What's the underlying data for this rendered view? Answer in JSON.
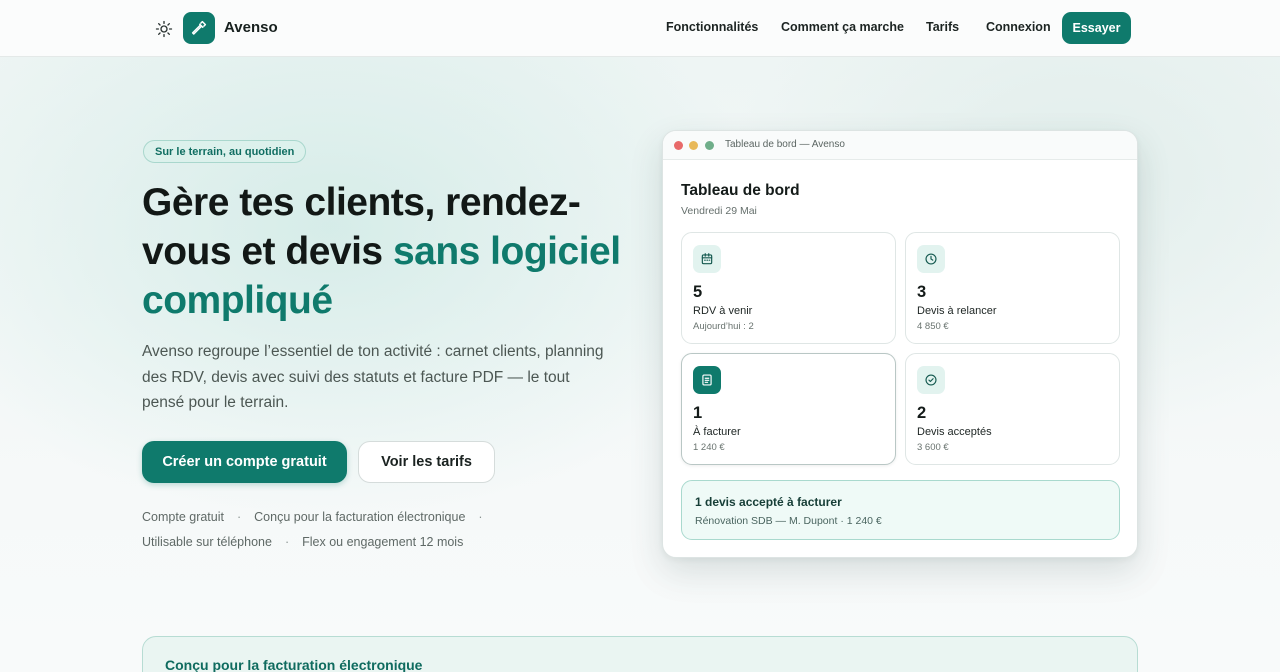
{
  "nav": {
    "brand": "Avenso",
    "links": [
      {
        "label": "Fonctionnalités"
      },
      {
        "label": "Comment ça marche"
      },
      {
        "label": "Tarifs"
      },
      {
        "label": "Connexion"
      }
    ],
    "cta": "Essayer",
    "icons": {
      "theme": "sun-icon",
      "logo": "hammer-icon"
    }
  },
  "hero": {
    "badge": "Sur le terrain, au quotidien",
    "headline_part1": "Gère tes clients, rendez-vous et devis",
    "headline_accent": "sans logiciel compliqué",
    "lede": "Avenso regroupe l’essentiel de ton activité : carnet clients, planning des RDV, devis avec suivi des statuts et facture PDF — le tout pensé pour le terrain.",
    "primary_button": "Créer un compte gratuit",
    "secondary_button": "Voir les tarifs",
    "features": [
      "Compte gratuit",
      "Conçu pour la facturation électronique",
      "Utilisable sur téléphone",
      "Flex ou engagement 12 mois"
    ],
    "separator": "·"
  },
  "dashboard": {
    "window_title": "Tableau de bord — Avenso",
    "title": "Tableau de bord",
    "date": "Vendredi 29 Mai",
    "cards": [
      {
        "icon": "calendar-icon",
        "value": "5",
        "label": "RDV à venir",
        "sub": "Aujourd’hui : 2"
      },
      {
        "icon": "clock-icon",
        "value": "3",
        "label": "Devis à relancer",
        "sub": "4 850 €"
      },
      {
        "icon": "document-icon",
        "value": "1",
        "label": "À facturer",
        "sub": "1 240 €"
      },
      {
        "icon": "check-circle-icon",
        "value": "2",
        "label": "Devis acceptés",
        "sub": "3 600 €"
      }
    ],
    "alert": {
      "title": "1 devis accepté à facturer",
      "sub": "Rénovation SDB — M. Dupont · 1 240 €"
    }
  },
  "bottom": {
    "title": "Conçu pour la facturation électronique"
  },
  "colors": {
    "accent": "#0f7a6c",
    "window_dot_red": "#e86a6a",
    "window_dot_yellow": "#e8b95a",
    "window_dot_green": "#6fae8a"
  }
}
